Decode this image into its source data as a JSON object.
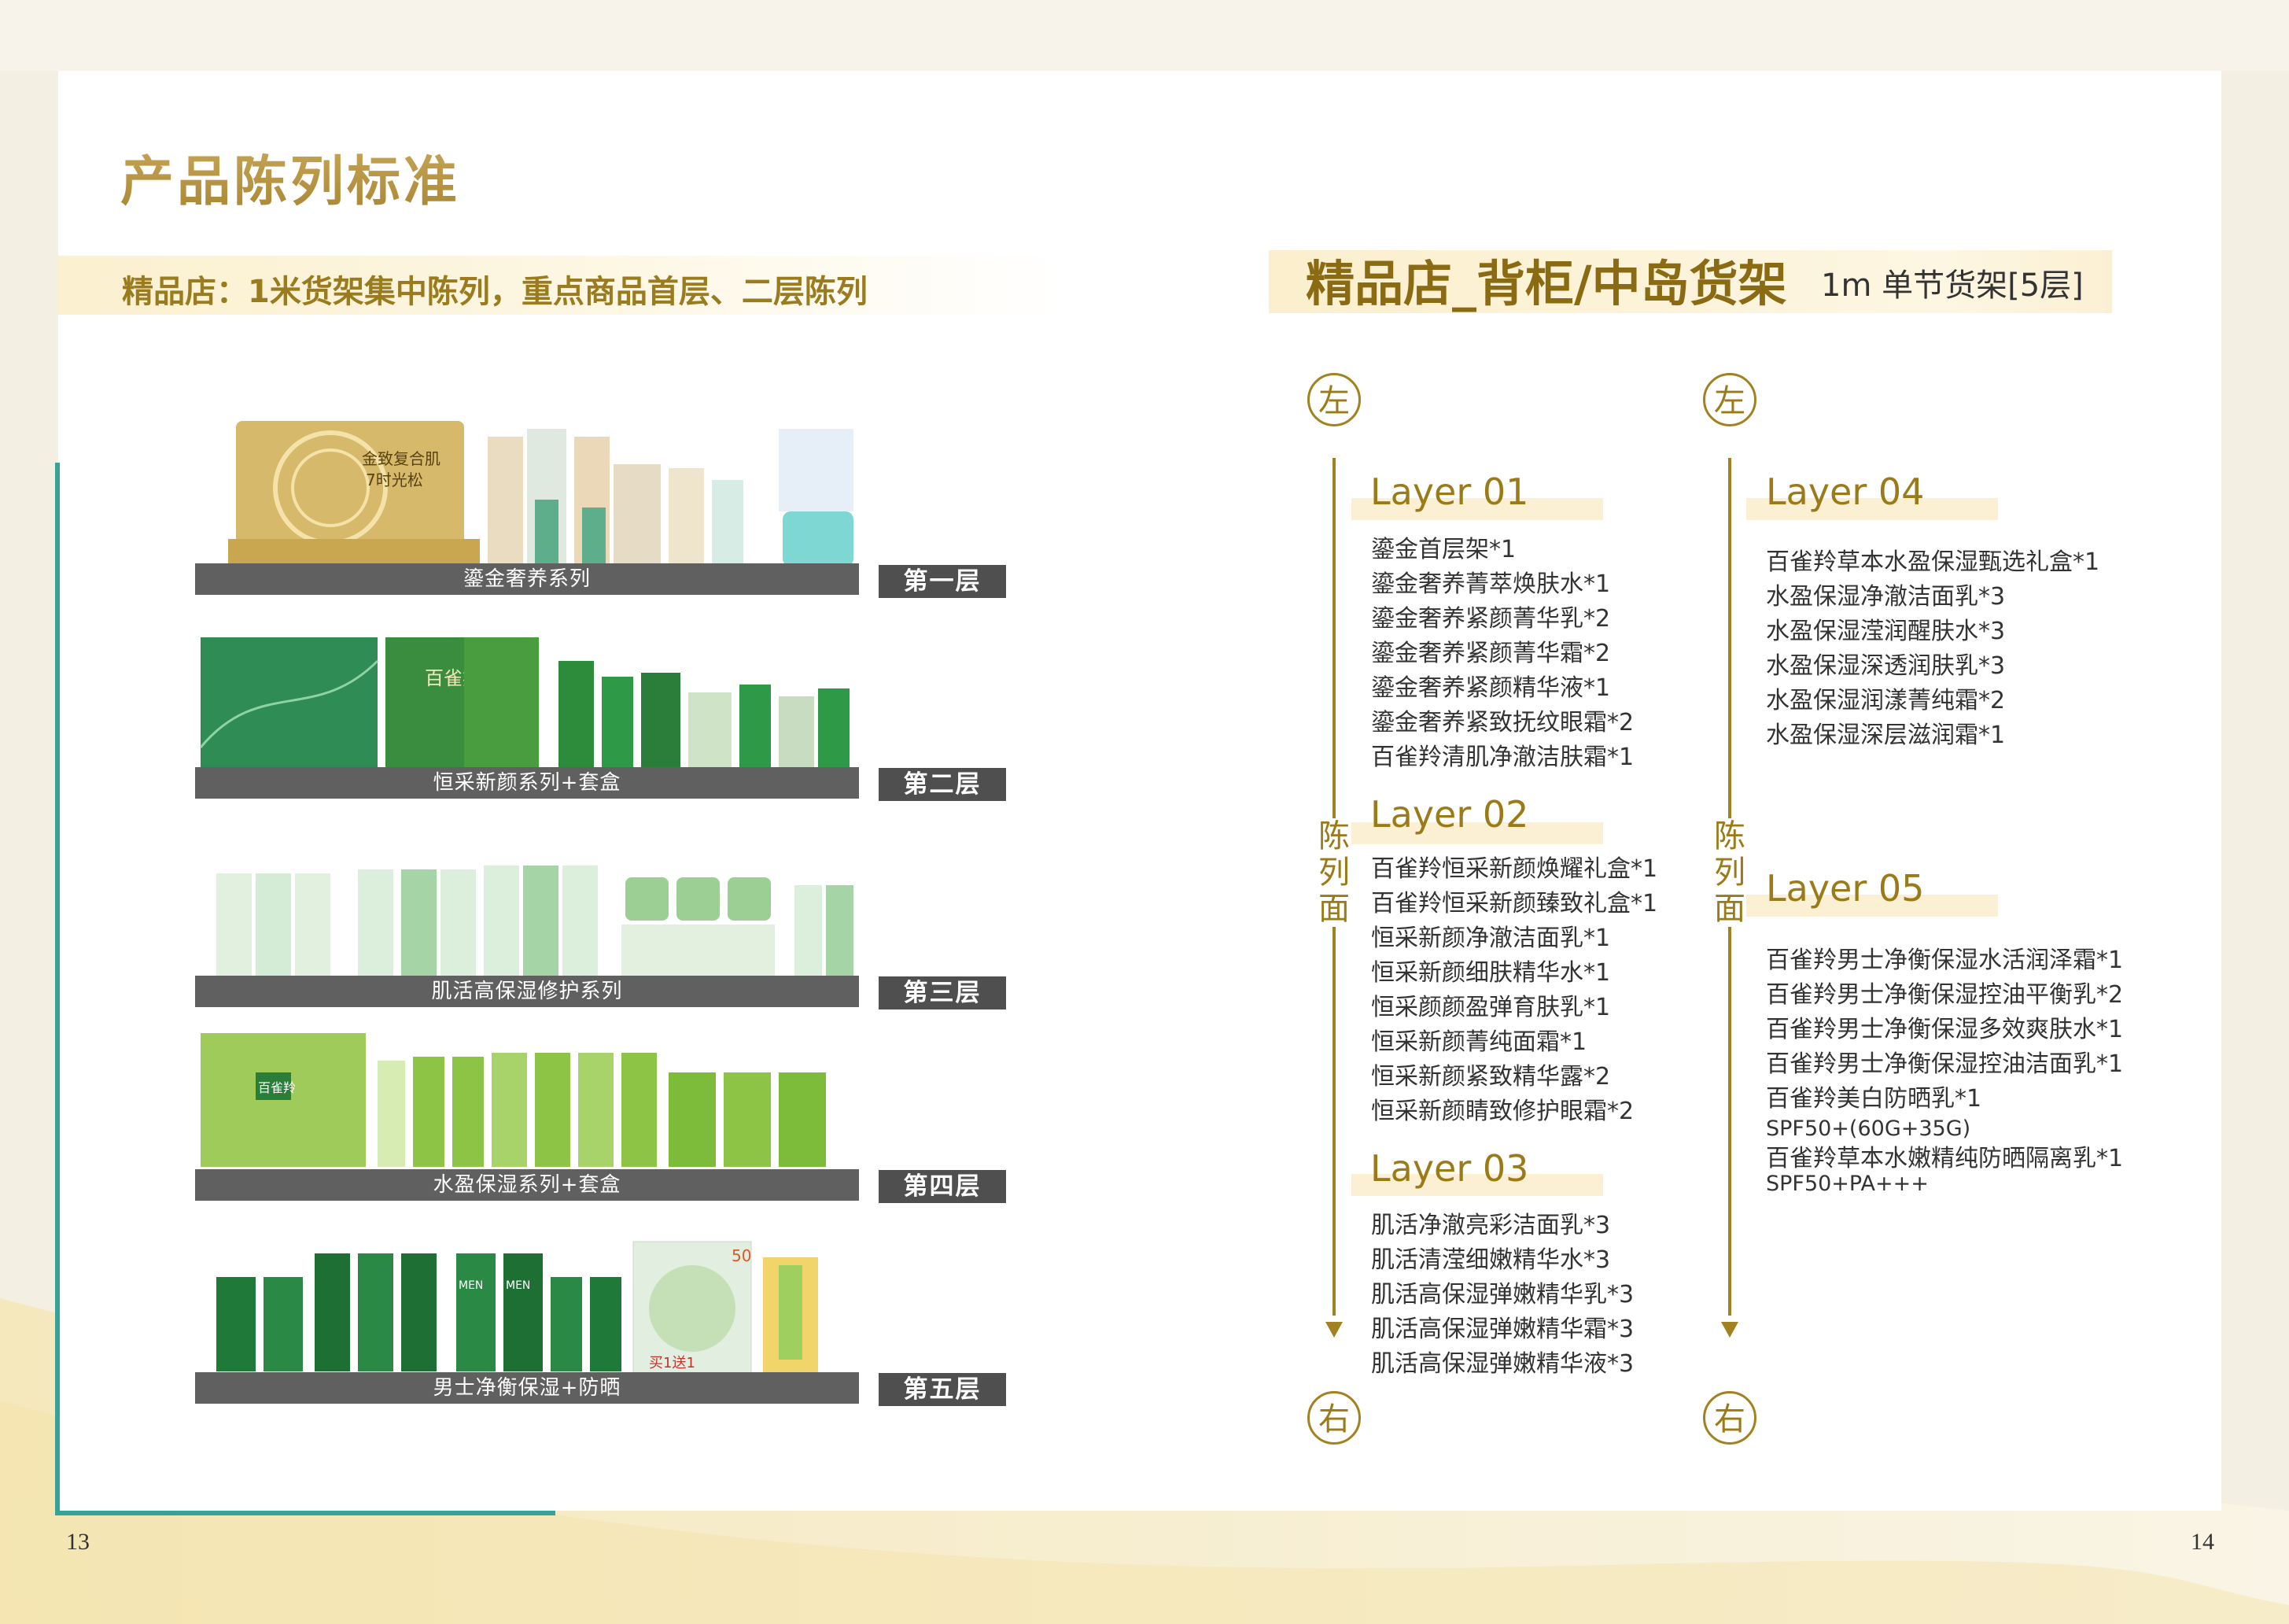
{
  "page": {
    "left_number": "13",
    "right_number": "14",
    "title": "产品陈列标准",
    "subtitle": "精品店：1米货架集中陈列，重点商品首层、二层陈列"
  },
  "shelves": [
    {
      "series": "鎏金奢养系列",
      "tag": "第一层",
      "photo_text": [
        "金致复合肌",
        "7时光松"
      ]
    },
    {
      "series": "恒采新颜系列+套盒",
      "tag": "第二层",
      "photo_text": [
        "百雀羚"
      ]
    },
    {
      "series": "肌活高保湿修护系列",
      "tag": "第三层"
    },
    {
      "series": "水盈保湿系列+套盒",
      "tag": "第四层",
      "photo_text": [
        "百雀羚"
      ]
    },
    {
      "series": "男士净衡保湿+防晒",
      "tag": "第五层",
      "photo_text": [
        "MEN",
        "MEN",
        "50",
        "买1送1"
      ]
    }
  ],
  "right": {
    "title": "精品店_背柜/中岛货架",
    "subtitle": "1m 单节货架[5层]",
    "left_marker": "左",
    "right_marker": "右",
    "side_label": [
      "陈",
      "列",
      "面"
    ]
  },
  "layers": [
    {
      "title": "Layer 01",
      "items": [
        "鎏金首层架*1",
        "鎏金奢养菁萃焕肤水*1",
        "鎏金奢养紧颜菁华乳*2",
        "鎏金奢养紧颜菁华霜*2",
        "鎏金奢养紧颜精华液*1",
        "鎏金奢养紧致抚纹眼霜*2",
        "百雀羚清肌净澈洁肤霜*1"
      ]
    },
    {
      "title": "Layer 02",
      "items": [
        "百雀羚恒采新颜焕耀礼盒*1",
        "百雀羚恒采新颜臻致礼盒*1",
        "恒采新颜净澈洁面乳*1",
        "恒采新颜细肤精华水*1",
        "恒采颜颜盈弹育肤乳*1",
        "恒采新颜菁纯面霜*1",
        "恒采新颜紧致精华露*2",
        "恒采新颜睛致修护眼霜*2"
      ]
    },
    {
      "title": "Layer 03",
      "items": [
        "肌活净澈亮彩洁面乳*3",
        "肌活清滢细嫩精华水*3",
        "肌活高保湿弹嫩精华乳*3",
        "肌活高保湿弹嫩精华霜*3",
        "肌活高保湿弹嫩精华液*3"
      ]
    },
    {
      "title": "Layer 04",
      "items": [
        "百雀羚草本水盈保湿甄选礼盒*1",
        "水盈保湿净澈洁面乳*3",
        "水盈保湿滢润醒肤水*3",
        "水盈保湿深透润肤乳*3",
        "水盈保湿润漾菁纯霜*2",
        "水盈保湿深层滋润霜*1"
      ]
    },
    {
      "title": "Layer 05",
      "items": [
        "百雀羚男士净衡保湿水活润泽霜*1",
        "百雀羚男士净衡保湿控油平衡乳*2",
        "百雀羚男士净衡保湿多效爽肤水*1",
        "百雀羚男士净衡保湿控油洁面乳*1",
        "百雀羚美白防晒乳*1",
        "SPF50+(60G+35G)",
        "百雀羚草本水嫩精纯防晒隔离乳*1",
        "SPF50+PA+++"
      ]
    }
  ],
  "colors": {
    "gold": "#9b7a18",
    "teal": "#37a397",
    "shelf_band": "#606060"
  }
}
